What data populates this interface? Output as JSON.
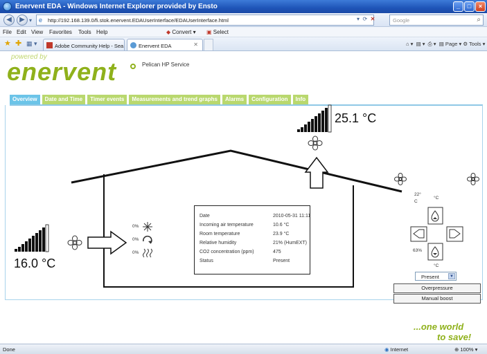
{
  "browser": {
    "window_title": "Enervent EDA - Windows Internet Explorer provided by Ensto",
    "url": "http://192.168.139.0/fi.stok.enervent.EDAUserInterface/EDAUserInterface.html",
    "search_placeholder": "Google",
    "menu": [
      "File",
      "Edit",
      "View",
      "Favorites",
      "Tools",
      "Help"
    ],
    "convert_label": "Convert",
    "select_label": "Select",
    "tabs": [
      {
        "label": "Adobe Community Help - Sea..."
      },
      {
        "label": "Enervent EDA"
      }
    ],
    "command_bar": {
      "page_label": "Page",
      "tools_label": "Tools"
    },
    "status": {
      "left": "Done",
      "zone": "Internet",
      "zoom": "100%"
    }
  },
  "header": {
    "powered_by": "powered by",
    "logo": "enervent",
    "subtitle": "Pelican HP Service"
  },
  "app_tabs": [
    {
      "label": "Overview",
      "active": true
    },
    {
      "label": "Date and Time",
      "active": false
    },
    {
      "label": "Timer events",
      "active": false
    },
    {
      "label": "Measurements and trend graphs",
      "active": false
    },
    {
      "label": "Alarms",
      "active": false
    },
    {
      "label": "Configuration",
      "active": false
    },
    {
      "label": "Info",
      "active": false
    }
  ],
  "overview": {
    "outdoor_temp": "16.0 °C",
    "exhaust_temp": "25.1 °C",
    "intake_components": [
      {
        "pct": "0%",
        "icon": "cooling-icon"
      },
      {
        "pct": "0%",
        "icon": "heat-recovery-icon"
      },
      {
        "pct": "0%",
        "icon": "heating-icon"
      }
    ],
    "setpoint": {
      "temp_value": "22°",
      "temp_unit_line": "C",
      "temp_unit": "°C",
      "humidity_value": "63%",
      "humidity_unit": "°C"
    },
    "mode_select": "Present",
    "buttons": {
      "overpressure": "Overpressure",
      "manual_boost": "Manual boost"
    },
    "info": [
      {
        "label": "Date",
        "value": "2010-05-31 11:11"
      },
      {
        "label": "Incoming air temperature",
        "value": "10.6 °C"
      },
      {
        "label": "Room temperature",
        "value": "23.9 °C"
      },
      {
        "label": "Relative humidity",
        "value": "21% (HumEXT)"
      },
      {
        "label": "CO2 concentration (ppm)",
        "value": "475"
      },
      {
        "label": "Status",
        "value": "Present"
      }
    ]
  },
  "slogan": {
    "line1": "...one world",
    "line2": "to save!"
  },
  "colors": {
    "brand_green": "#8fb11b",
    "tab_blue": "#6cc4e8",
    "tab_green": "#b9d86e"
  }
}
